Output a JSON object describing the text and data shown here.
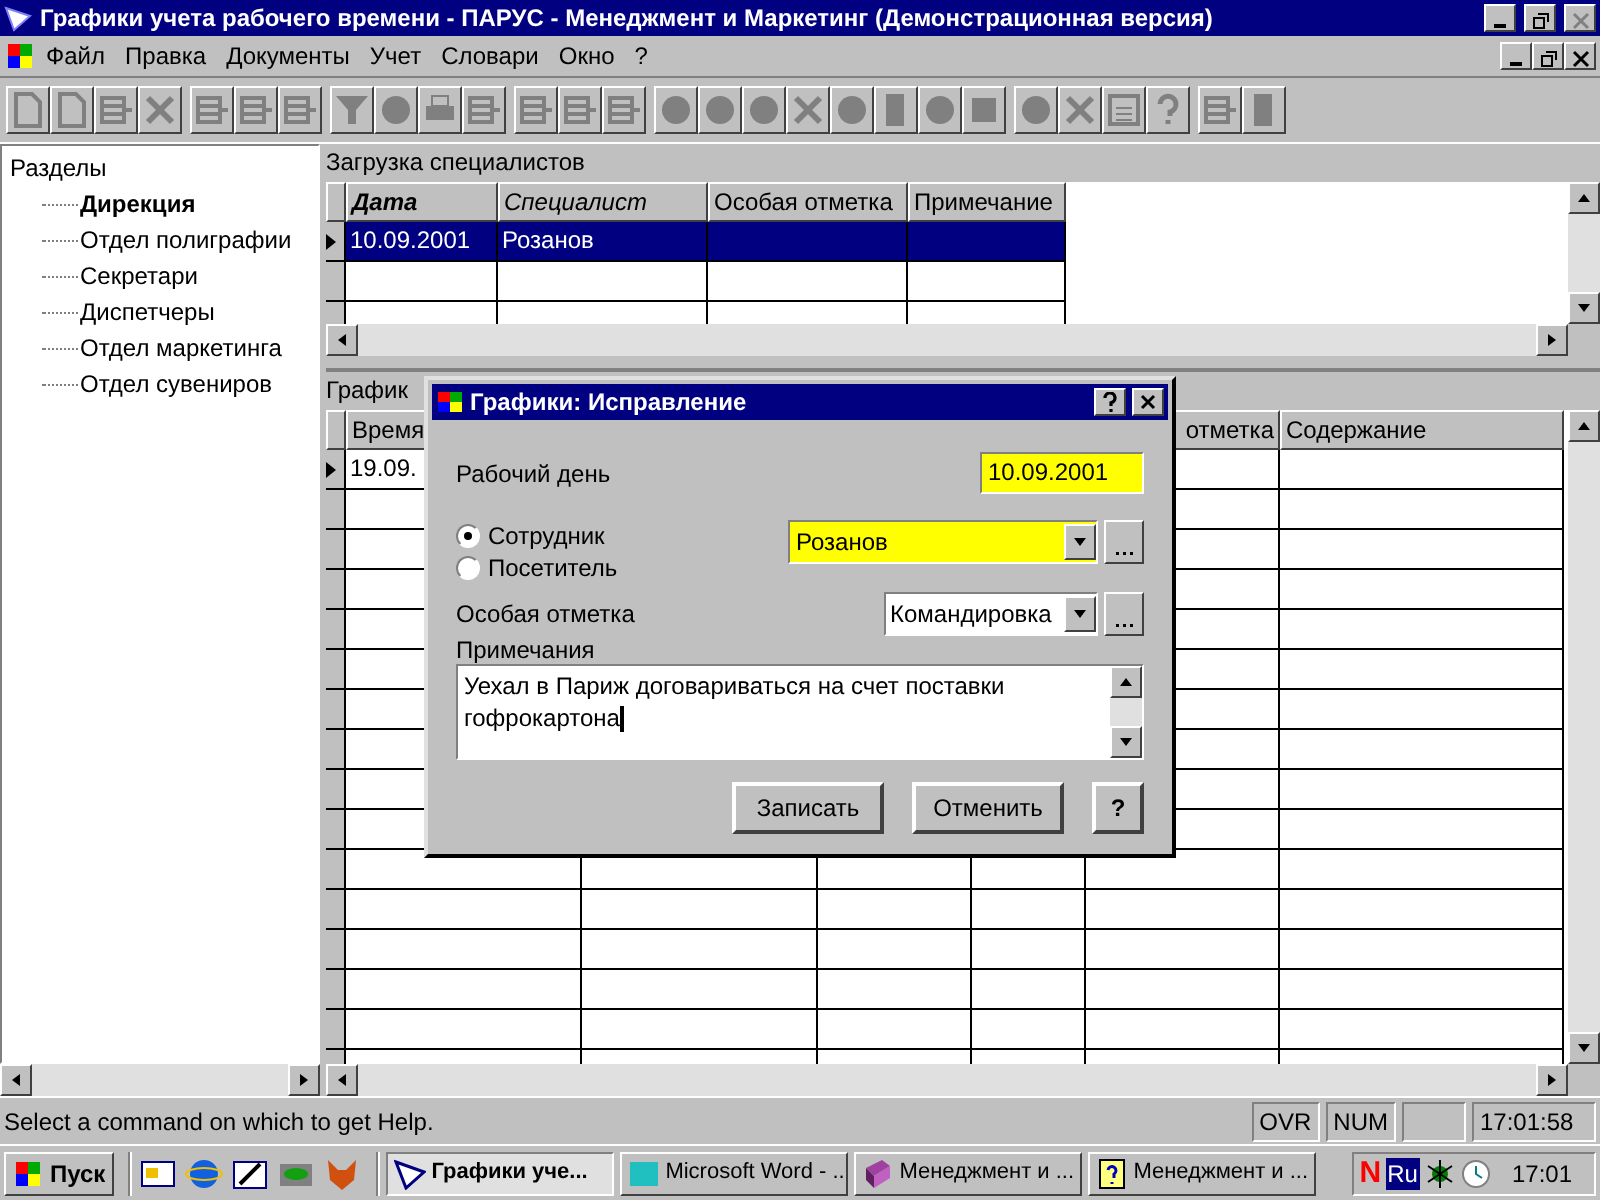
{
  "window": {
    "title": "Графики учета рабочего времени - ПАРУС - Менеджмент и Маркетинг (Демонстрационная версия)"
  },
  "menu": [
    "Файл",
    "Правка",
    "Документы",
    "Учет",
    "Словари",
    "Окно",
    "?"
  ],
  "tree": {
    "label": "Разделы",
    "children": [
      {
        "label": "Дирекция",
        "selected": true
      },
      {
        "label": "Отдел полиграфии",
        "selected": false
      },
      {
        "label": "Секретари",
        "selected": false
      },
      {
        "label": "Диспетчеры",
        "selected": false
      },
      {
        "label": "Отдел маркетинга",
        "selected": false
      },
      {
        "label": "Отдел сувениров",
        "selected": false
      }
    ]
  },
  "upper_grid": {
    "caption": "Загрузка специалистов",
    "columns": [
      {
        "label": "Дата",
        "kind": "sorted"
      },
      {
        "label": "Специалист",
        "kind": "linked"
      },
      {
        "label": "Особая отметка",
        "kind": "plain"
      },
      {
        "label": "Примечание",
        "kind": "plain"
      }
    ],
    "rows": [
      {
        "cells": [
          "10.09.2001",
          "Розанов",
          "",
          ""
        ],
        "selected": true
      }
    ]
  },
  "lower_grid": {
    "caption": "График",
    "columns": [
      {
        "label": "Время"
      },
      {},
      {},
      {},
      {
        "label": "отметка"
      },
      {
        "label": "Содержание"
      }
    ],
    "rows": [
      {
        "cells": [
          "19.09."
        ],
        "current": true
      }
    ]
  },
  "dialog": {
    "title": "Графики: Исправление",
    "work_day": {
      "label": "Рабочий день",
      "value": "10.09.2001"
    },
    "person_type": [
      {
        "label": "Сотрудник",
        "selected": true
      },
      {
        "label": "Посетитель",
        "selected": false
      }
    ],
    "person": {
      "value": "Розанов"
    },
    "mark": {
      "label": "Особая отметка",
      "value": "Командировка"
    },
    "notes": {
      "label": "Примечания",
      "value": "Уехал в Париж договариваться на счет поставки гофрокартона"
    },
    "buttons": [
      "Записать",
      "Отменить",
      "?"
    ]
  },
  "status_bar": {
    "message": "Select a command on which to get Help.",
    "panels": [
      "OVR",
      "NUM"
    ],
    "time": "17:01:58"
  },
  "taskbar": {
    "start": "Пуск",
    "tasks": [
      {
        "label": "Графики уче...",
        "kind": "app",
        "selected": true
      },
      {
        "label": "Microsoft Word - ...",
        "kind": "word",
        "selected": false
      },
      {
        "label": "Менеджмент и ...",
        "kind": "book",
        "selected": false
      },
      {
        "label": "Менеджмент и ...",
        "kind": "help",
        "selected": false
      }
    ],
    "tray": {
      "indicator": "N",
      "language": "Ru",
      "time": "17:01"
    }
  }
}
